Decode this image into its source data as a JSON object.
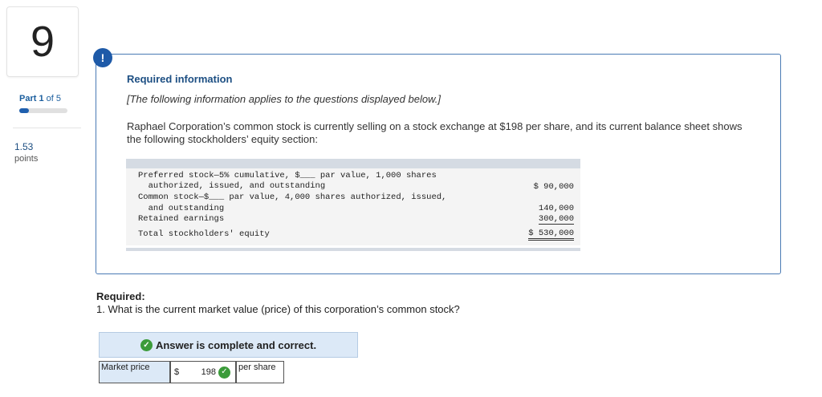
{
  "question_number": "9",
  "part": {
    "prefix": "Part",
    "current": "1",
    "of": "of 5",
    "progress_fraction": 0.2
  },
  "points": {
    "value": "1.53",
    "label": "points"
  },
  "alert_icon": "!",
  "required_info": {
    "title": "Required information",
    "note": "[The following information applies to the questions displayed below.]",
    "body": "Raphael Corporation’s common stock is currently selling on a stock exchange at $198 per share, and its current balance sheet shows the following stockholders’ equity section:"
  },
  "equity": {
    "line1": "Preferred stock—5% cumulative, $___ par value, 1,000 shares",
    "line2": "  authorized, issued, and outstanding",
    "line3": "Common stock—$___ par value, 4,000 shares authorized, issued,",
    "line4": "  and outstanding",
    "line5": "Retained earnings",
    "line6": "Total stockholders' equity",
    "amt_preferred": "$ 90,000",
    "amt_common": "140,000",
    "amt_retained": "300,000",
    "amt_total": "$ 530,000"
  },
  "required": {
    "label": "Required:",
    "question": "1. What is the current market value (price) of this corporation’s common stock?"
  },
  "answer": {
    "banner": "Answer is complete and correct.",
    "row_label": "Market price",
    "currency": "$",
    "value": "198",
    "unit": "per share"
  },
  "colors": {
    "accent": "#1e5aa8",
    "correct": "#3b9b3a",
    "banner_bg": "#dce9f7"
  }
}
